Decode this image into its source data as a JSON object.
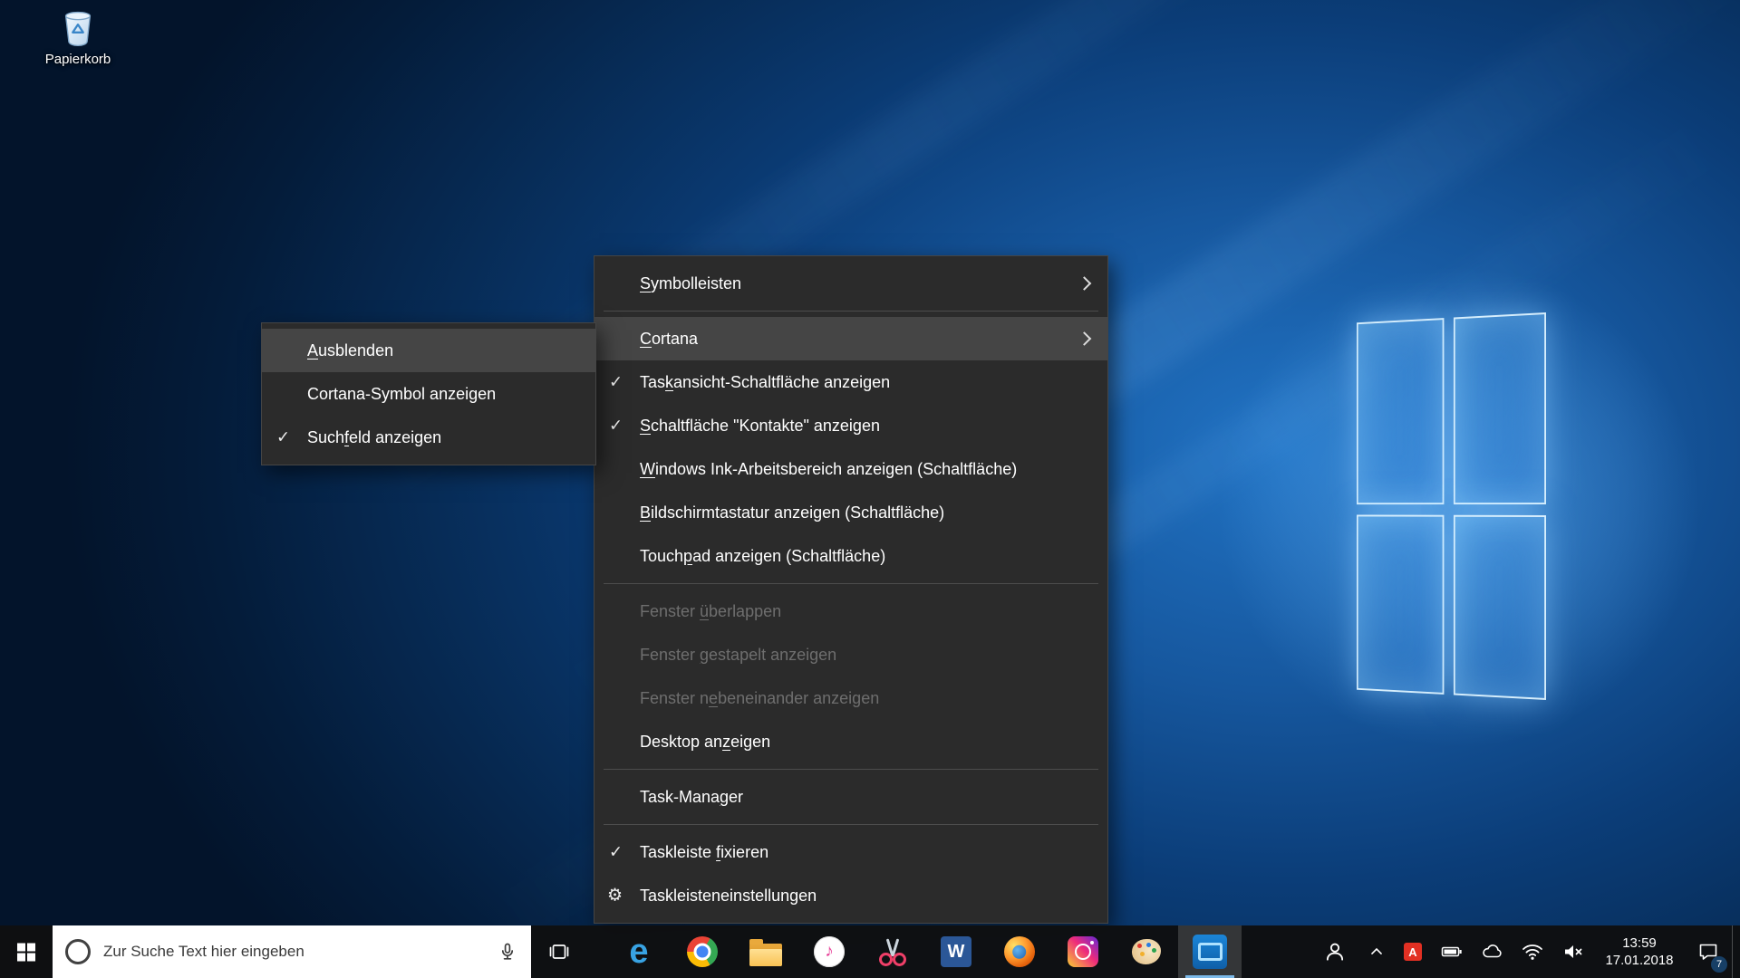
{
  "desktop": {
    "recycle_bin_label": "Papierkorb"
  },
  "cortana_submenu": {
    "items": [
      {
        "pre": "",
        "accel": "A",
        "post": "usblenden",
        "highlighted": true
      },
      {
        "pre": "Cortana-Symbol anzeigen",
        "accel": "",
        "post": ""
      },
      {
        "pre": "Such",
        "accel": "f",
        "post": "eld anzeigen",
        "checked": true
      }
    ]
  },
  "context_menu": {
    "items": [
      {
        "pre": "",
        "accel": "S",
        "post": "ymbolleisten",
        "submenu": true
      },
      {
        "pre": "",
        "accel": "C",
        "post": "ortana",
        "submenu": true,
        "highlighted": true
      },
      {
        "pre": "Tas",
        "accel": "k",
        "post": "ansicht-Schaltfläche anzeigen",
        "checked": true
      },
      {
        "pre": "",
        "accel": "S",
        "post": "chaltfläche \"Kontakte\" anzeigen",
        "checked": true
      },
      {
        "pre": "",
        "accel": "W",
        "post": "indows Ink-Arbeitsbereich anzeigen (Schaltfläche)"
      },
      {
        "pre": "",
        "accel": "B",
        "post": "ildschirmtastatur anzeigen (Schaltfläche)"
      },
      {
        "pre": "Touch",
        "accel": "p",
        "post": "ad anzeigen (Schaltfläche)"
      },
      {
        "pre": "Fenster ",
        "accel": "ü",
        "post": "berlappen",
        "disabled": true
      },
      {
        "pre": "Fenster ",
        "accel": "g",
        "post": "estapelt anzeigen",
        "disabled": true
      },
      {
        "pre": "Fenster n",
        "accel": "e",
        "post": "beneinander anzeigen",
        "disabled": true
      },
      {
        "pre": "Desktop an",
        "accel": "z",
        "post": "eigen"
      },
      {
        "pre": "Task-Mana",
        "accel": "g",
        "post": "er"
      },
      {
        "pre": "Taskleiste ",
        "accel": "f",
        "post": "ixieren",
        "checked": true
      },
      {
        "pre": "Taskleisteneinstellungen",
        "accel": "",
        "post": "",
        "gear": true
      }
    ]
  },
  "taskbar": {
    "search": {
      "placeholder": "Zur Suche Text hier eingeben"
    },
    "apps": [
      "edge",
      "chrome",
      "file-explorer",
      "itunes",
      "scissors-app",
      "word",
      "firefox",
      "instagram",
      "paint",
      "active-blue-app"
    ],
    "tray_icons": [
      "people",
      "tray-expand-chevron",
      "red-tray-app",
      "battery",
      "onedrive-cloud",
      "wifi",
      "volume-muted"
    ],
    "tray_red_glyph": "A",
    "clock": {
      "time": "13:59",
      "date": "17.01.2018"
    },
    "action_center": {
      "badge": "7"
    }
  },
  "glyphs": {
    "check": "✓",
    "gear": "⚙"
  },
  "colors": {
    "menu_bg": "#2b2b2b",
    "menu_highlight": "#454545",
    "menu_disabled_text": "#6e6e6e",
    "taskbar_bg": "#0e0f11",
    "active_underline": "#7cb9e8",
    "wallpaper_glow": "#2173c4"
  }
}
